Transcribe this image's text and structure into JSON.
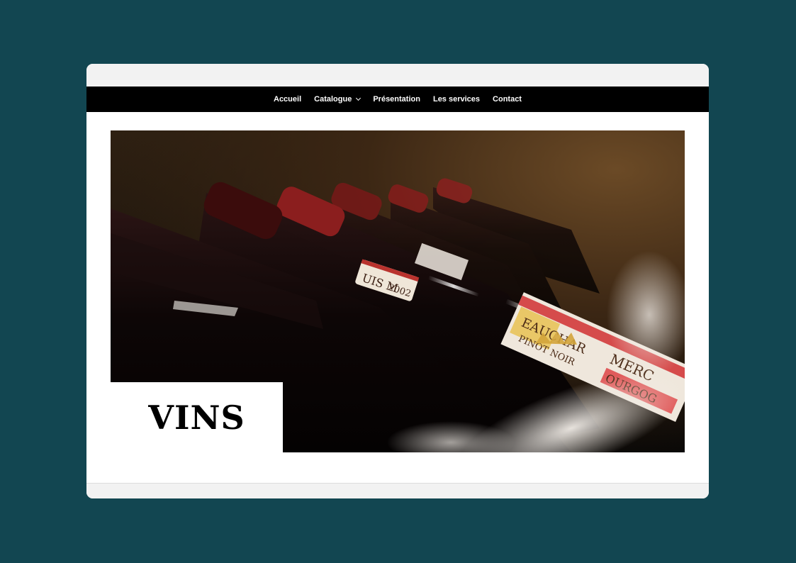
{
  "nav": {
    "items": [
      {
        "label": "Accueil"
      },
      {
        "label": "Catalogue",
        "has_dropdown": true
      },
      {
        "label": "Présentation"
      },
      {
        "label": "Les services"
      },
      {
        "label": "Contact"
      }
    ]
  },
  "hero": {
    "title": "VINS",
    "image": "wine-bottles-photo",
    "label_texts": [
      "UIS M",
      "2002",
      "EAUCHAR",
      "PINOT NOIR",
      "MERC",
      "OURGOG"
    ]
  },
  "colors": {
    "page_background": "#124651",
    "nav_background": "#000000",
    "window_background": "#ffffff",
    "chrome": "#f2f2f2"
  }
}
